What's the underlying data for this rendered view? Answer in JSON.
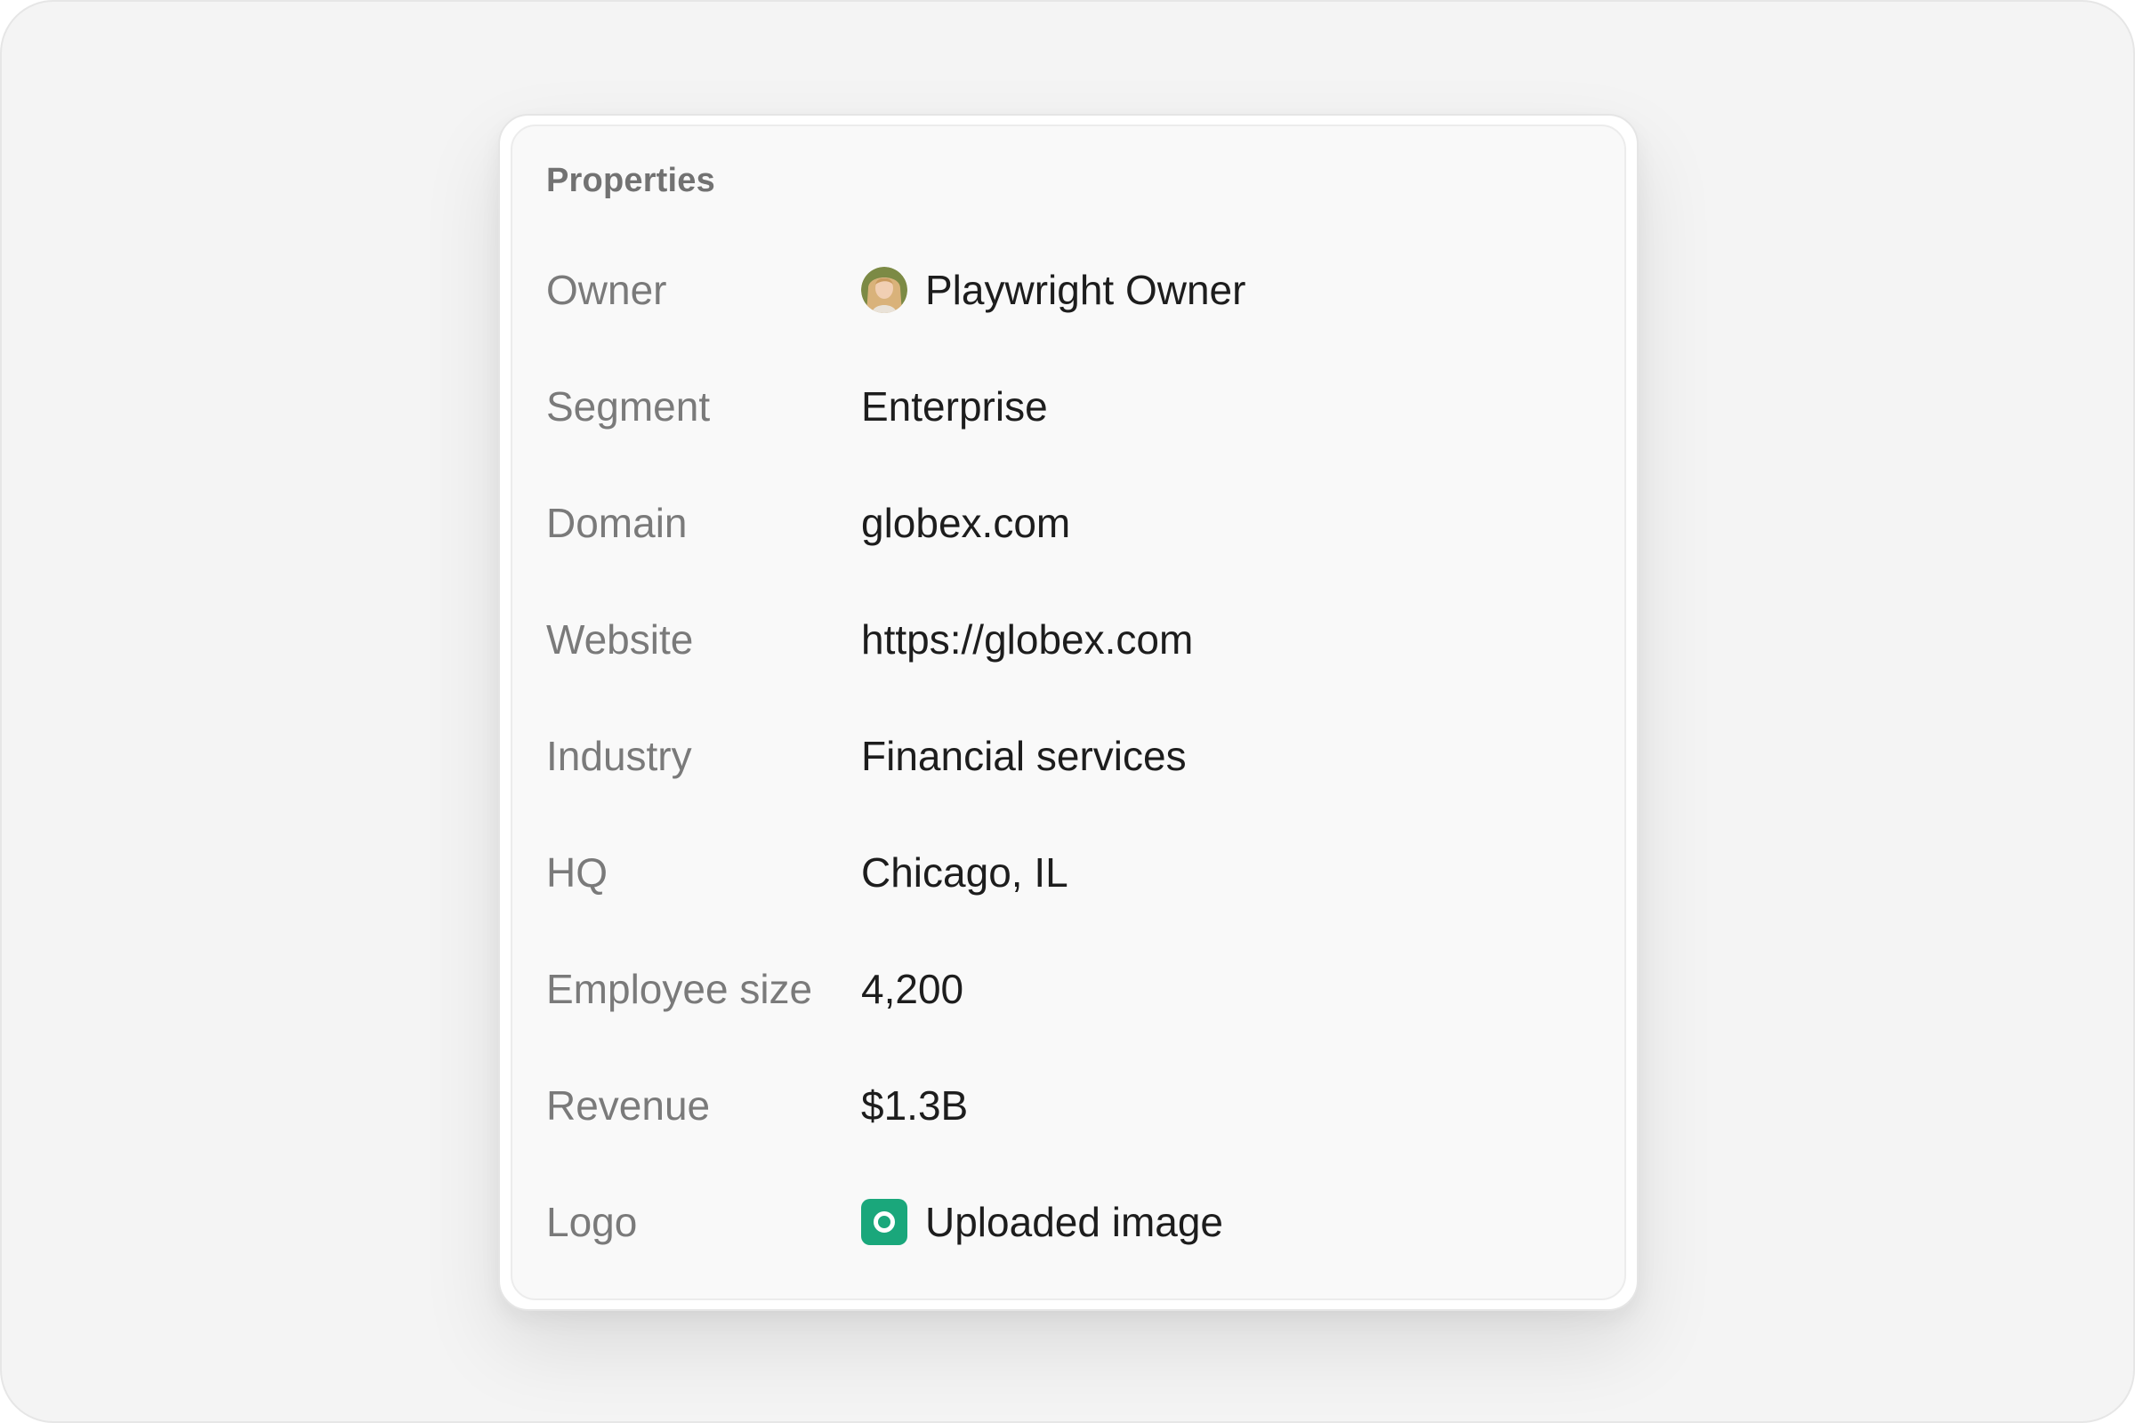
{
  "panel": {
    "title": "Properties",
    "properties": [
      {
        "label": "Owner",
        "value": "Playwright Owner",
        "icon": "avatar"
      },
      {
        "label": "Segment",
        "value": "Enterprise"
      },
      {
        "label": "Domain",
        "value": "globex.com"
      },
      {
        "label": "Website",
        "value": "https://globex.com"
      },
      {
        "label": "Industry",
        "value": "Financial services"
      },
      {
        "label": "HQ",
        "value": "Chicago, IL"
      },
      {
        "label": "Employee size",
        "value": "4,200"
      },
      {
        "label": "Revenue",
        "value": "$1.3B"
      },
      {
        "label": "Logo",
        "value": "Uploaded image",
        "icon": "image-icon"
      }
    ]
  },
  "colors": {
    "page_background": "#f4f4f4",
    "card_background": "#f9f9f9",
    "label_text": "#7a7a7a",
    "value_text": "#1d1d1d",
    "logo_accent": "#1aa77b"
  }
}
